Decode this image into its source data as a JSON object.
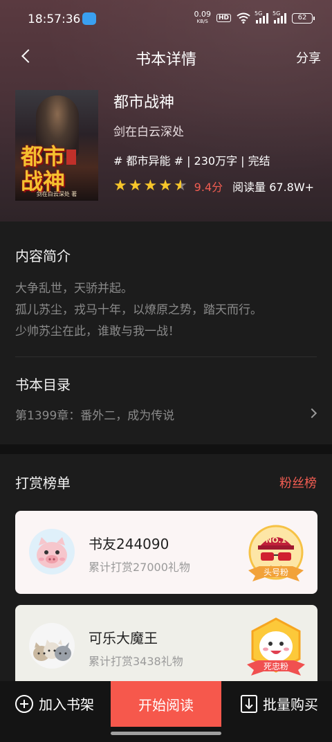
{
  "status": {
    "time": "18:57:36",
    "net_speed": "0.09",
    "net_unit": "KB/S",
    "hd": "HD",
    "sig1": "5G",
    "sig2": "5G",
    "battery": "62"
  },
  "nav": {
    "title": "书本详情",
    "share": "分享"
  },
  "book": {
    "cover_title": "都市战神",
    "cover_author": "剑在白云深处 著",
    "title": "都市战神",
    "author": "剑在白云深处",
    "tags": "# 都市异能 # | 230万字 | 完结",
    "rating": 4.5,
    "score": "9.4分",
    "reads": "阅读量 67.8W+"
  },
  "intro": {
    "title": "内容简介",
    "lines": [
      "大争乱世，天骄并起。",
      "孤儿苏尘，戎马十年，以燎原之势，踏天而行。",
      "少帅苏尘在此，谁敢与我一战！"
    ]
  },
  "catalog": {
    "title": "书本目录",
    "latest": "第1399章：番外二，成为传说"
  },
  "rewards": {
    "title": "打赏榜单",
    "fans_link": "粉丝榜",
    "items": [
      {
        "name": "书友244090",
        "gift": "累计打赏27000礼物",
        "badge_top": "NO.1",
        "badge_label": "头号粉",
        "avatar": "pig-avatar"
      },
      {
        "name": "可乐大魔王",
        "gift": "累计打赏3438礼物",
        "badge_label": "死忠粉",
        "avatar": "cats-avatar"
      }
    ]
  },
  "bottom": {
    "add_shelf": "加入书架",
    "start_read": "开始阅读",
    "bulk_buy": "批量购买"
  },
  "colors": {
    "accent": "#f6584c",
    "score": "#f25d52",
    "star": "#f6c52a",
    "bg": "#1c1c1c"
  }
}
